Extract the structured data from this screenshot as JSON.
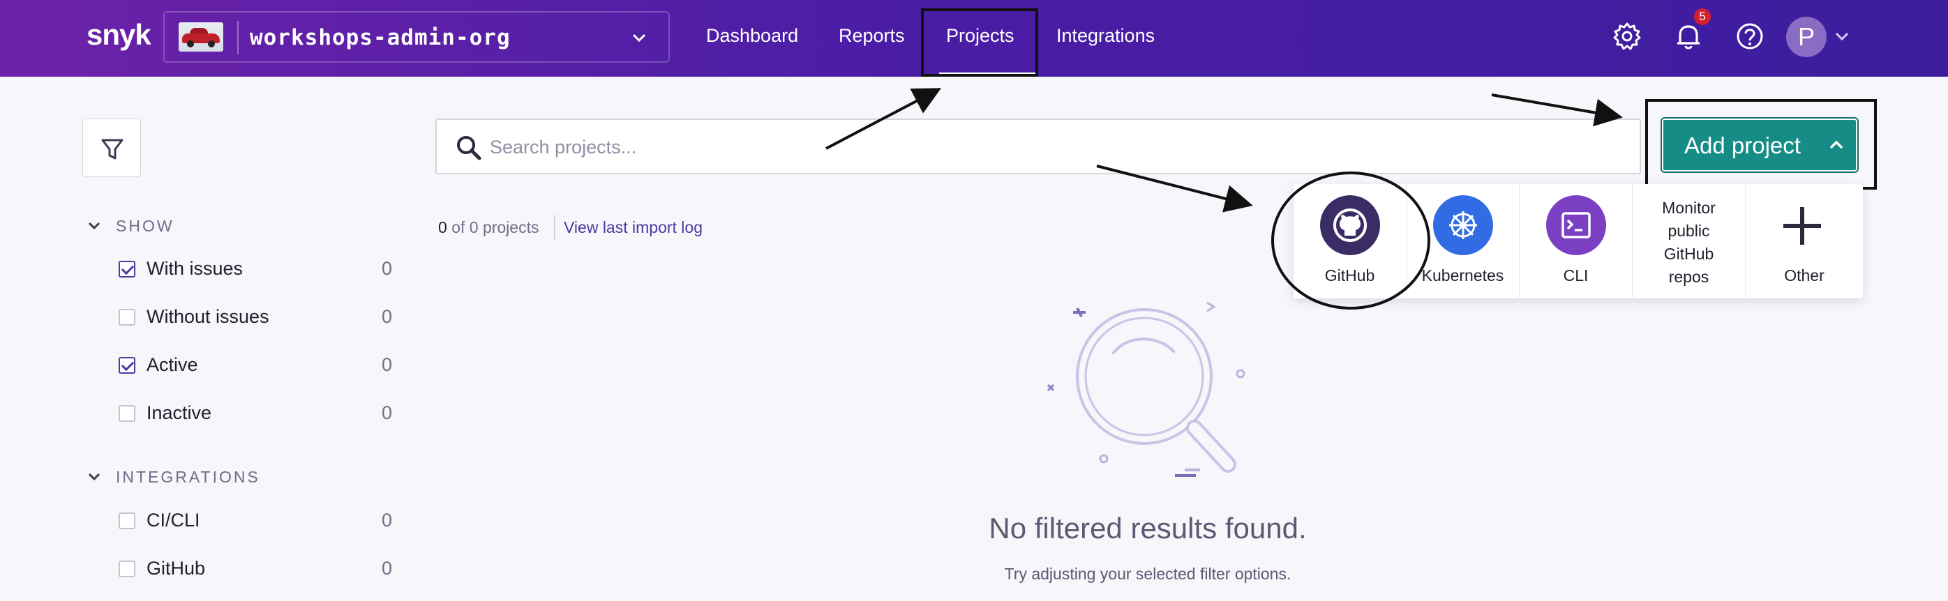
{
  "header": {
    "logo": "snyk",
    "org_name": "workshops-admin-org",
    "nav": [
      {
        "label": "Dashboard"
      },
      {
        "label": "Reports"
      },
      {
        "label": "Projects",
        "active": true
      },
      {
        "label": "Integrations"
      }
    ],
    "notifications_count": "5",
    "avatar_initial": "P",
    "icons": [
      "gear-icon",
      "bell-icon",
      "help-icon",
      "chevron-down-icon"
    ]
  },
  "sidebar": {
    "show_heading": "SHOW",
    "show_filters": [
      {
        "label": "With issues",
        "count": "0",
        "checked": true
      },
      {
        "label": "Without issues",
        "count": "0",
        "checked": false
      },
      {
        "label": "Active",
        "count": "0",
        "checked": true
      },
      {
        "label": "Inactive",
        "count": "0",
        "checked": false
      }
    ],
    "integrations_heading": "INTEGRATIONS",
    "integration_filters": [
      {
        "label": "CI/CLI",
        "count": "0",
        "checked": false
      },
      {
        "label": "GitHub",
        "count": "0",
        "checked": false
      }
    ]
  },
  "search": {
    "placeholder": "Search projects..."
  },
  "projects_summary": {
    "count": "0",
    "suffix": "of 0 projects",
    "import_log_link": "View last import log"
  },
  "empty_state": {
    "title": "No filtered results found.",
    "subtitle": "Try adjusting your selected filter options."
  },
  "add_project": {
    "button_label": "Add project",
    "options": [
      {
        "label": "GitHub",
        "icon": "github-icon",
        "color": "#3a2d66"
      },
      {
        "label": "Kubernetes",
        "icon": "kubernetes-icon",
        "color": "#326ce5"
      },
      {
        "label": "CLI",
        "icon": "terminal-icon",
        "color": "#7b3fc4"
      },
      {
        "label_lines": [
          "Monitor",
          "public",
          "GitHub",
          "repos"
        ]
      },
      {
        "label": "Other",
        "icon": "plus-icon"
      }
    ]
  },
  "colors": {
    "header_start": "#6c22a8",
    "header_end": "#3d1d9e",
    "accent_teal": "#168c86",
    "link_purple": "#4b3aa0",
    "badge_red": "#d41e2f"
  }
}
